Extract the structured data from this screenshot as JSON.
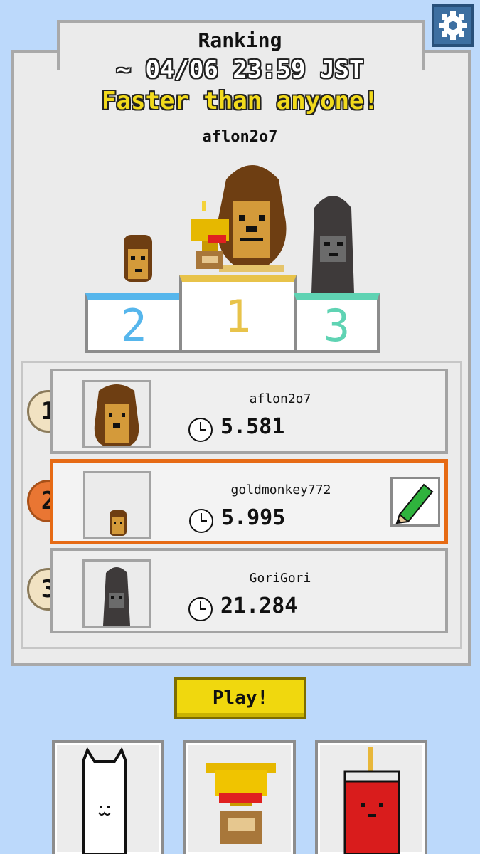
{
  "header": {
    "title": "Ranking",
    "period": "~ 04/06 23:59 JST",
    "subtitle": "Faster than anyone!",
    "champion": "aflon2o7"
  },
  "podium": [
    {
      "place": "2",
      "color": "#56b6ec"
    },
    {
      "place": "1",
      "color": "#e8c34a"
    },
    {
      "place": "3",
      "color": "#5fd3b3"
    }
  ],
  "ranking": [
    {
      "rank": "1",
      "name": "aflon2o7",
      "time": "5.581",
      "avatar": "lion-icon"
    },
    {
      "rank": "2",
      "name": "goldmonkey772",
      "time": "5.995",
      "avatar": "monkey-icon",
      "highlight": true
    },
    {
      "rank": "3",
      "name": "GoriGori",
      "time": "21.284",
      "avatar": "gorilla-icon"
    }
  ],
  "play_button": "Play!",
  "colors": {
    "accent": "#e66a14",
    "play": "#f0d80e",
    "background": "#bcd9fb"
  }
}
